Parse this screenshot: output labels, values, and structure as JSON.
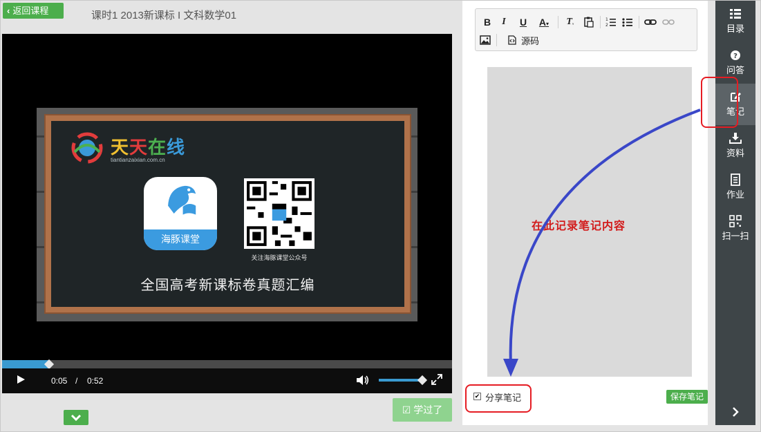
{
  "top": {
    "back_label": "返回课程",
    "lesson_title": "课时1  2013新课标 I 文科数学01"
  },
  "video": {
    "logo_text": [
      "天",
      "天",
      "在",
      "线"
    ],
    "logo_url": "tiantianzaixian.com.cn",
    "app_label": "海豚课堂",
    "qr_caption": "关注海豚课堂公众号",
    "board_heading": "全国高考新课标卷真题汇编"
  },
  "player": {
    "current_time": "0:05",
    "separator": "/",
    "total_time": "0:52",
    "progress_fraction": 0.105,
    "volume_fraction": 0.98
  },
  "actions": {
    "learned_label": "学过了"
  },
  "editor": {
    "toolbar": {
      "bold": "B",
      "italic": "I",
      "underline": "U",
      "font_color": "A",
      "remove_format": "T",
      "source": "源码"
    },
    "share_label": "分享笔记",
    "share_checked": true,
    "save_label": "保存笔记"
  },
  "nav": {
    "items": [
      {
        "label": "目录",
        "icon": "list-icon"
      },
      {
        "label": "问答",
        "icon": "question-icon"
      },
      {
        "label": "笔记",
        "icon": "note-edit-icon",
        "active": true
      },
      {
        "label": "资料",
        "icon": "download-icon"
      },
      {
        "label": "作业",
        "icon": "homework-icon"
      },
      {
        "label": "扫一扫",
        "icon": "qr-scan-icon"
      }
    ]
  },
  "annotation": {
    "text": "在此记录笔记内容",
    "color": "#e51c23",
    "arrow_color": "#3a47c8"
  },
  "colors": {
    "green": "#4cae4c",
    "green_light": "#8fd38f",
    "nav_bg": "#3e4548",
    "progress": "#3a9ad0"
  }
}
